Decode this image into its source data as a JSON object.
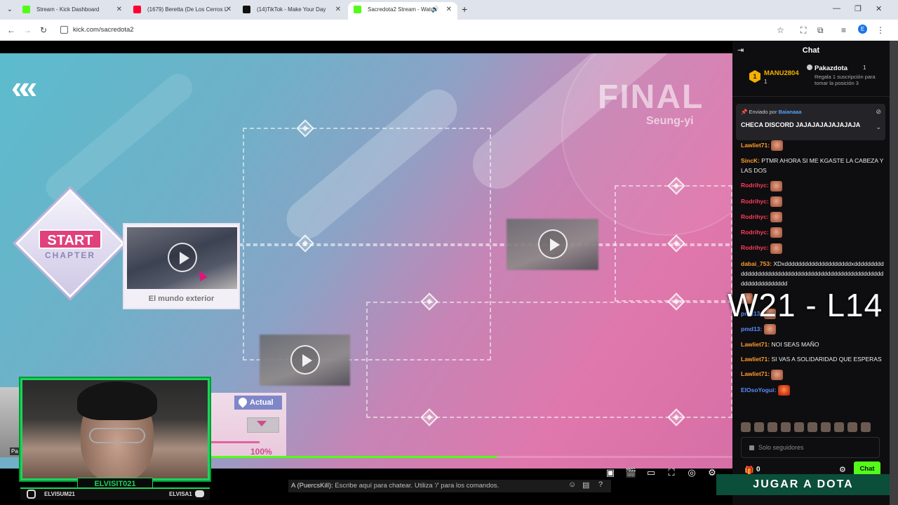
{
  "browser": {
    "tabs": [
      {
        "title": "Stream - Kick Dashboard",
        "color": "#53fc18"
      },
      {
        "title": "(1679) Beretta (De Los Cerros L",
        "color": "#ff0033"
      },
      {
        "title": "(14)TikTok - Make Your Day",
        "color": "#111111"
      },
      {
        "title": "Sacredota2 Stream - Watch",
        "color": "#53fc18"
      }
    ],
    "url": "kick.com/sacredota2",
    "profile_initial": "E"
  },
  "game": {
    "final_title": "FINAL",
    "final_subtitle": "Seung-yi",
    "start_label": "START",
    "chapter_label": "CHAPTER",
    "scene_title": "El mundo exterior",
    "actual_label": "Actual",
    "progress_percent": "100%",
    "stream_progress": 0.55
  },
  "webcam": {
    "name": "ELVISIT021",
    "instagram": "ELVISUM21",
    "discord": "ELVISA1",
    "side_label": "Pa"
  },
  "overlay_chat": {
    "user": "A (PuercsKill):",
    "placeholder": "Escribe aquí para chatear. Utiliza '/' para los comandos."
  },
  "chat": {
    "title": "Chat",
    "leaderboard": [
      {
        "rank": "1",
        "name": "MANU2804",
        "count": "1",
        "color": "#f5b000"
      },
      {
        "name": "Pakazdota",
        "count": "1",
        "color": "#ffffff"
      }
    ],
    "leader_note": "Regala 1 suscripción para tomar la posición 3",
    "pinned": {
      "by_label": "Enviado por",
      "by_user": "Baianaaa",
      "message": "CHECA DISCORD JAJAJAJAJAJAJAJA"
    },
    "messages": [
      {
        "user": "Lawliet71:",
        "text": "",
        "emote": true,
        "color": "#ff9b2f"
      },
      {
        "user": "SincK:",
        "text": "PTMR AHORA SI ME KGASTE LA CABEZA Y LAS DOS",
        "emote": false,
        "color": "#ff9b2f"
      },
      {
        "user": "Rodrihyc:",
        "text": "",
        "emote": true,
        "color": "#ff3b5c"
      },
      {
        "user": "Rodrihyc:",
        "text": "",
        "emote": true,
        "color": "#ff3b5c"
      },
      {
        "user": "Rodrihyc:",
        "text": "",
        "emote": true,
        "color": "#ff3b5c"
      },
      {
        "user": "Rodrihyc:",
        "text": "",
        "emote": true,
        "color": "#ff3b5c"
      },
      {
        "user": "Rodrihyc:",
        "text": "",
        "emote": true,
        "color": "#ff3b5c"
      },
      {
        "user": "dabai_753:",
        "text": "XDxddddddddddddddddddddxdddddddddddddddddddddddddddddddddddddddddddddddddddddddddddddddddd",
        "emote": false,
        "color": "#ff9b2f"
      },
      {
        "user": "",
        "text": "",
        "emote": true,
        "color": "#ff9b2f"
      },
      {
        "user": "pmd13:",
        "text": "",
        "emote": true,
        "color": "#5b8dff"
      },
      {
        "user": "pmd13:",
        "text": "",
        "emote": true,
        "color": "#5b8dff"
      },
      {
        "user": "Lawliet71:",
        "text": "NOI SEAS MAÑO",
        "emote": false,
        "color": "#ff9b2f"
      },
      {
        "user": "Lawliet71:",
        "text": "SI VAS A SOLIDARIDAD QUE ESPERAS",
        "emote": false,
        "color": "#ff9b2f"
      },
      {
        "user": "Lawliet71:",
        "text": "",
        "emote": true,
        "color": "#ff9b2f"
      },
      {
        "user": "ElOsoYogui:",
        "text": "",
        "emote": true,
        "color": "#5b8dff"
      }
    ],
    "score": "W21 - L14",
    "input_placeholder": "Solo seguidores",
    "gift_count": "0",
    "send_label": "Chat",
    "promo_label": "JUGAR A DOTA"
  }
}
